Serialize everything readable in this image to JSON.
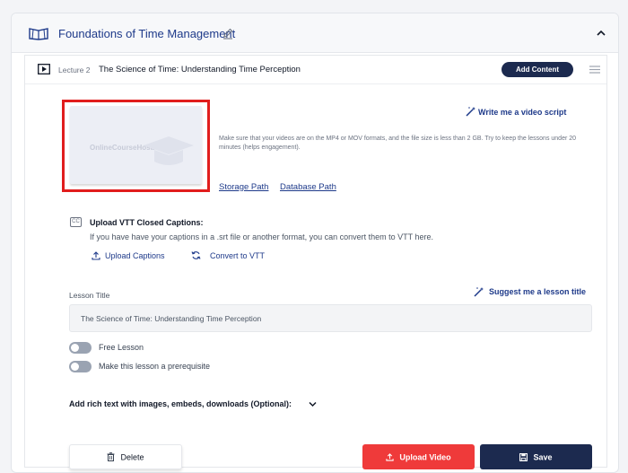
{
  "section": {
    "title": "Foundations of Time Management",
    "icon": "book-open-icon",
    "edit_icon": "pencil-icon",
    "collapse_icon": "chevron-up-icon"
  },
  "lecture": {
    "number": "Lecture 2",
    "title": "The Science of Time: Understanding Time Perception",
    "add_content_label": "Add Content",
    "menu_icon": "hamburger-icon"
  },
  "video": {
    "thumbnail_logo": "OnlineCourseHost.com",
    "write_script_label": "Write me a video script",
    "info_text": "Make sure that your videos are on the MP4 or MOV formats, and the file size is less than 2 GB. Try to keep the lessons under 20 minutes (helps engagement).",
    "storage_path_label": "Storage Path",
    "database_path_label": "Database Path"
  },
  "captions": {
    "title": "Upload VTT Closed Captions:",
    "description": "If you have have your captions in a .srt file or another format, you can convert them to VTT here.",
    "cc_badge": "CC",
    "upload_label": "Upload Captions",
    "convert_label": "Convert to VTT"
  },
  "lesson": {
    "title_label": "Lesson Title",
    "suggest_label": "Suggest me a lesson title",
    "title_value": "The Science of Time: Understanding Time Perception",
    "free_lesson_label": "Free Lesson",
    "prerequisite_label": "Make this lesson a prerequisite",
    "rich_text_label": "Add rich text with images, embeds, downloads (Optional):"
  },
  "actions": {
    "delete_label": "Delete",
    "upload_video_label": "Upload Video",
    "save_label": "Save"
  },
  "colors": {
    "brand_navy": "#1c2a4f",
    "link_blue": "#1e3a8a",
    "danger_red": "#ef3a3a",
    "highlight_red": "#e11d1d"
  }
}
